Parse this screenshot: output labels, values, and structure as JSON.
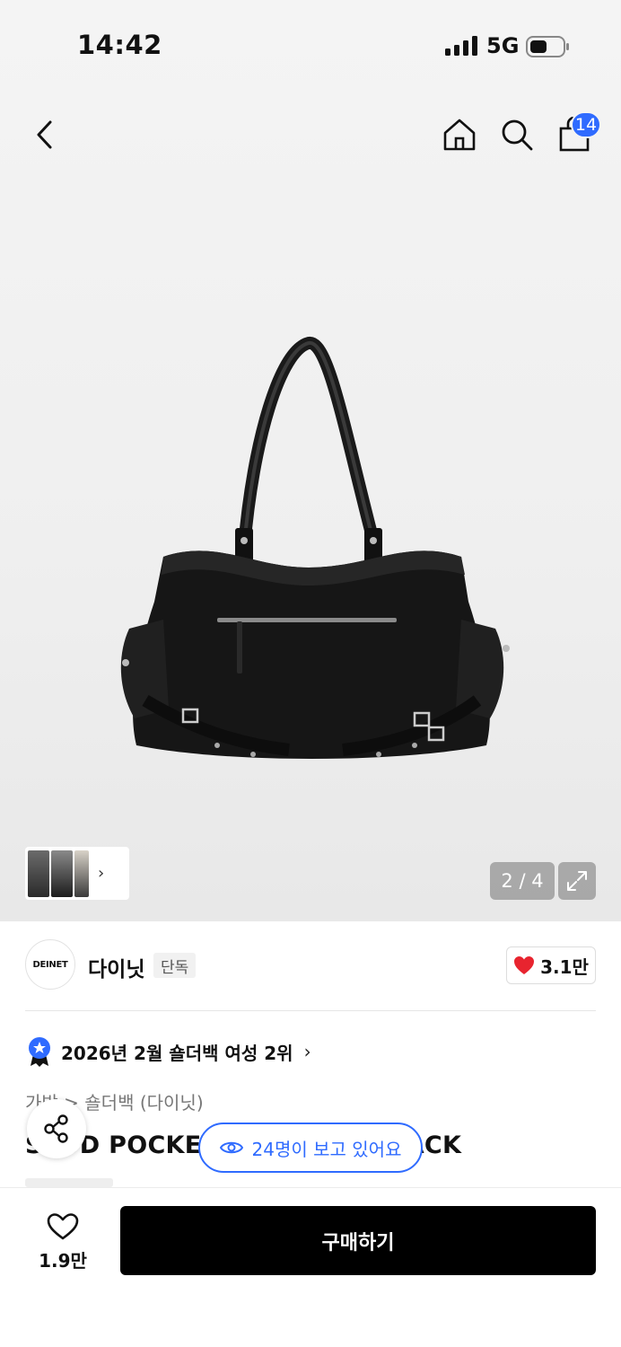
{
  "status_bar": {
    "time": "14:42",
    "network": "5G"
  },
  "header": {
    "cart_count": "14"
  },
  "gallery": {
    "counter": "2 / 4"
  },
  "brand": {
    "logo_text": "DEINET",
    "name": "다이닛",
    "tag": "단독",
    "likes": "3.1만"
  },
  "ranking": {
    "text": "2026년 2월 숄더백 여성 2위"
  },
  "breadcrumb": "가방 > 숄더백 (다이닛)",
  "product": {
    "title": "STUD POCKET SHOULDER BACK"
  },
  "viewers": {
    "text": "24명이 보고 있어요"
  },
  "bottom": {
    "wish_count": "1.9만",
    "buy_label": "구매하기"
  },
  "colors": {
    "accent": "#2f6bff",
    "like_red": "#e8242f",
    "buy_bg": "#000000"
  }
}
